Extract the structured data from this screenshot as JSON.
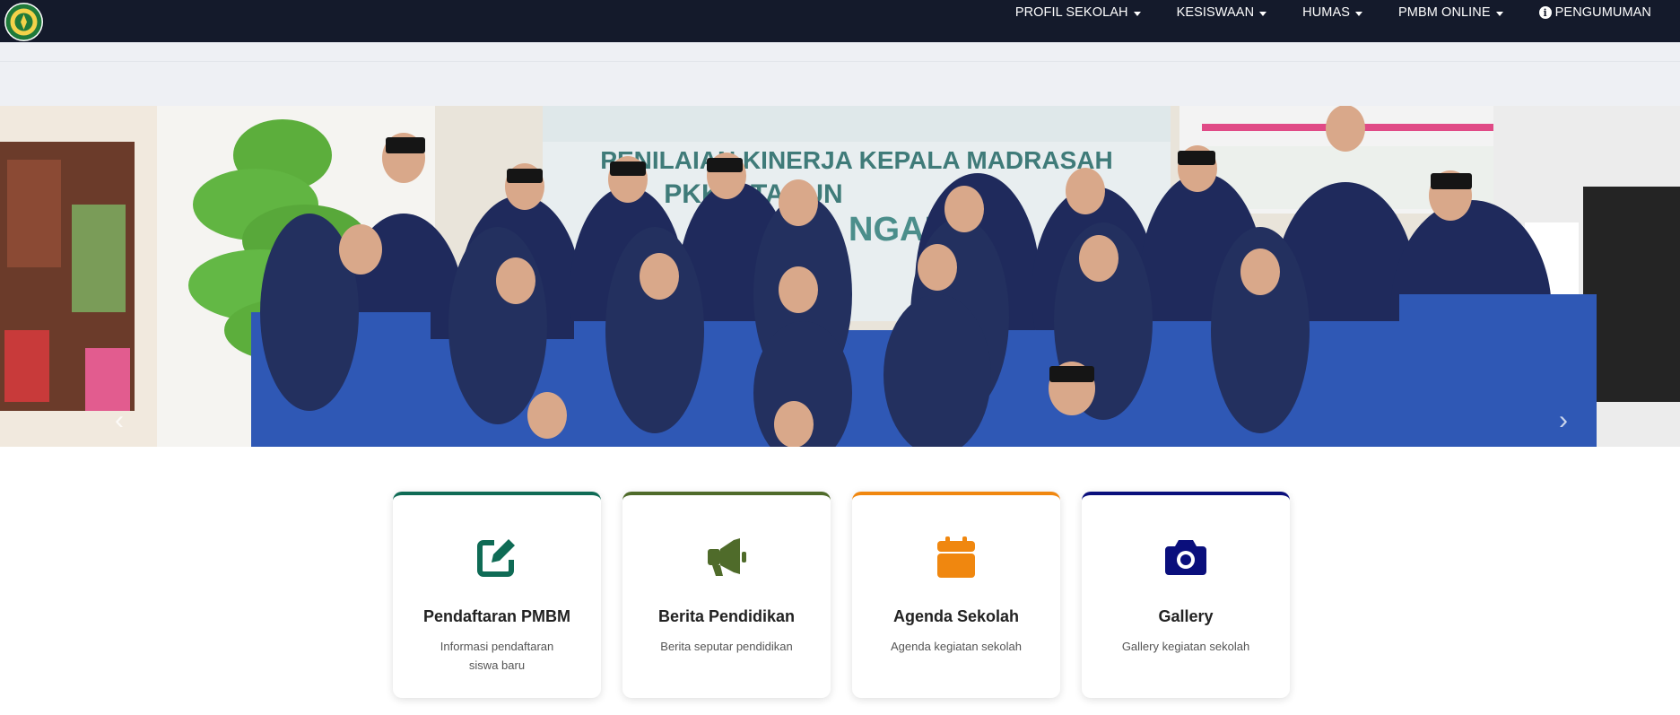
{
  "navbar": {
    "items": [
      {
        "label": "PROFIL SEKOLAH"
      },
      {
        "label": "KESISWAAN"
      },
      {
        "label": "HUMAS"
      },
      {
        "label": "PMBM ONLINE"
      },
      {
        "label": "PENGUMUMAN"
      }
    ]
  },
  "hero": {
    "banner_text": "PENILAIAN KINERJA KEPALA MADRASAH",
    "banner_text_2": "PKKM TAHUN",
    "banner_text_3": "NGANJUK",
    "prev_icon": "chevron-left-icon",
    "next_icon": "chevron-right-icon"
  },
  "cards": [
    {
      "title": "Pendaftaran PMBM",
      "desc": "Informasi pendaftaran siswa baru",
      "icon": "edit-icon",
      "color": "#0f6b55"
    },
    {
      "title": "Berita Pendidikan",
      "desc": "Berita seputar pendidikan",
      "icon": "megaphone-icon",
      "color": "#4f6b2a"
    },
    {
      "title": "Agenda Sekolah",
      "desc": "Agenda kegiatan sekolah",
      "icon": "calendar-icon",
      "color": "#f0870f"
    },
    {
      "title": "Gallery",
      "desc": "Gallery kegiatan sekolah",
      "icon": "camera-icon",
      "color": "#0a0f7c"
    }
  ]
}
